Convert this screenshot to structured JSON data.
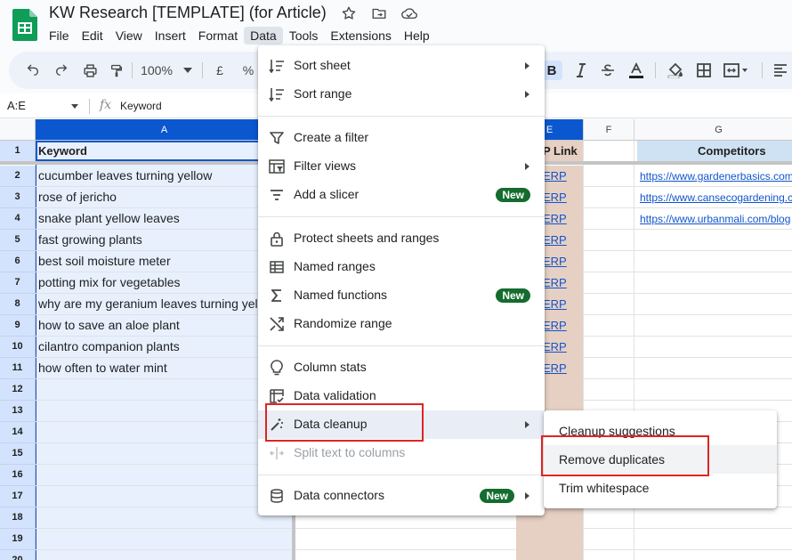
{
  "doc": {
    "title": "KW Research [TEMPLATE] (for Article)"
  },
  "menubar": [
    "File",
    "Edit",
    "View",
    "Insert",
    "Format",
    "Data",
    "Tools",
    "Extensions",
    "Help"
  ],
  "toolbar": {
    "zoom": "100%",
    "currency": "£",
    "percent": "%",
    "bold": "B"
  },
  "formula_bar": {
    "name_box": "A:E",
    "fx": "fx",
    "content": "Keyword"
  },
  "sheet": {
    "columns": [
      "A",
      "E",
      "F",
      "G"
    ],
    "rows": [
      "1",
      "2",
      "3",
      "4",
      "5",
      "6",
      "7",
      "8",
      "9",
      "10",
      "11",
      "12",
      "13",
      "14",
      "15",
      "16",
      "17",
      "18",
      "19",
      "20"
    ],
    "header": {
      "keyword": "Keyword",
      "serp": "P Link",
      "competitors": "Competitors"
    },
    "keywords": [
      "cucumber leaves turning yellow",
      "rose of jericho",
      "snake plant yellow leaves",
      "fast growing plants",
      "best soil moisture meter",
      "potting mix for vegetables",
      "why are my geranium leaves turning yellow",
      "how to save an aloe plant",
      "cilantro companion plants",
      "how often to water mint"
    ],
    "serp_link": "ERP",
    "competitor_links": [
      "https://www.gardenerbasics.com",
      "https://www.cansecogardening.com",
      "https://www.urbanmali.com/blog"
    ]
  },
  "data_menu": {
    "items": [
      {
        "label": "Sort sheet",
        "icon": "sort-icon",
        "submenu": true
      },
      {
        "label": "Sort range",
        "icon": "sort-range-icon",
        "submenu": true
      },
      {
        "label": "Create a filter",
        "icon": "filter-icon"
      },
      {
        "label": "Filter views",
        "icon": "filter-views-icon",
        "submenu": true
      },
      {
        "label": "Add a slicer",
        "icon": "slicer-icon",
        "badge": "New"
      },
      {
        "label": "Protect sheets and ranges",
        "icon": "lock-icon"
      },
      {
        "label": "Named ranges",
        "icon": "named-ranges-icon"
      },
      {
        "label": "Named functions",
        "icon": "sigma-icon",
        "badge": "New"
      },
      {
        "label": "Randomize range",
        "icon": "shuffle-icon"
      },
      {
        "label": "Column stats",
        "icon": "lightbulb-icon"
      },
      {
        "label": "Data validation",
        "icon": "data-validation-icon"
      },
      {
        "label": "Data cleanup",
        "icon": "magic-wand-icon",
        "submenu": true
      },
      {
        "label": "Split text to columns",
        "icon": "split-icon",
        "disabled": true
      },
      {
        "label": "Data connectors",
        "icon": "database-icon",
        "badge": "New",
        "submenu": true
      }
    ]
  },
  "cleanup_submenu": {
    "items": [
      "Cleanup suggestions",
      "Remove duplicates",
      "Trim whitespace"
    ]
  },
  "colors": {
    "accent": "#0b57d0",
    "badge": "#146c2e",
    "highlight_box": "#e02424"
  }
}
